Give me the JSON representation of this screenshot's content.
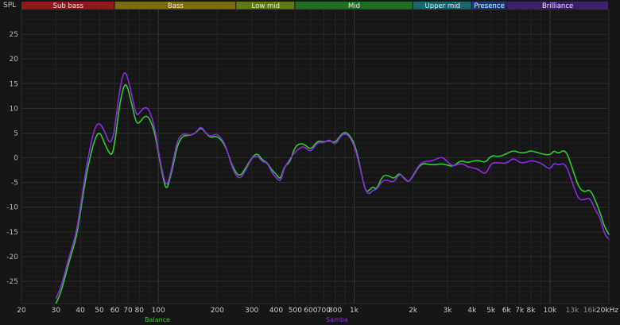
{
  "chart_data": {
    "type": "line",
    "ylabel": "SPL",
    "xscale": "log",
    "xlim": [
      20,
      20000
    ],
    "ylim": [
      -29.5,
      30
    ],
    "grid": true,
    "y_ticks": [
      25,
      20,
      15,
      10,
      5,
      0,
      -5,
      -10,
      -15,
      -20,
      -25
    ],
    "x_ticks": [
      {
        "value": 20,
        "label": "20",
        "major": true
      },
      {
        "value": 30,
        "label": "30",
        "major": true
      },
      {
        "value": 40,
        "label": "40",
        "major": true
      },
      {
        "value": 50,
        "label": "50",
        "major": true
      },
      {
        "value": 60,
        "label": "60",
        "major": true
      },
      {
        "value": 70,
        "label": "70",
        "major": true
      },
      {
        "value": 80,
        "label": "80",
        "major": true
      },
      {
        "value": 100,
        "label": "100",
        "major": true
      },
      {
        "value": 200,
        "label": "200",
        "major": true
      },
      {
        "value": 300,
        "label": "300",
        "major": true
      },
      {
        "value": 400,
        "label": "400",
        "major": true
      },
      {
        "value": 500,
        "label": "500",
        "major": true
      },
      {
        "value": 600,
        "label": "600",
        "major": true
      },
      {
        "value": 700,
        "label": "700",
        "major": true
      },
      {
        "value": 800,
        "label": "800",
        "major": true
      },
      {
        "value": 1000,
        "label": "1k",
        "major": true
      },
      {
        "value": 2000,
        "label": "2k",
        "major": true
      },
      {
        "value": 3000,
        "label": "3k",
        "major": true
      },
      {
        "value": 4000,
        "label": "4k",
        "major": true
      },
      {
        "value": 5000,
        "label": "5k",
        "major": true
      },
      {
        "value": 6000,
        "label": "6k",
        "major": true
      },
      {
        "value": 7000,
        "label": "7k",
        "major": true
      },
      {
        "value": 8000,
        "label": "8k",
        "major": true
      },
      {
        "value": 10000,
        "label": "10k",
        "major": true
      },
      {
        "value": 13000,
        "label": "13k",
        "major": false
      },
      {
        "value": 16000,
        "label": "16k",
        "major": false
      },
      {
        "value": 20000,
        "label": "20kHz",
        "major": true
      }
    ],
    "bands": [
      {
        "label": "Sub bass",
        "from": 20,
        "to": 60,
        "color": "#8b1a1a"
      },
      {
        "label": "Bass",
        "from": 60,
        "to": 250,
        "color": "#7d6a12"
      },
      {
        "label": "Low mid",
        "from": 250,
        "to": 500,
        "color": "#5f7a14"
      },
      {
        "label": "Mid",
        "from": 500,
        "to": 2000,
        "color": "#1f6f1f"
      },
      {
        "label": "Upper mid",
        "from": 2000,
        "to": 4000,
        "color": "#1b6470"
      },
      {
        "label": "Presence",
        "from": 4000,
        "to": 6000,
        "color": "#1c3f7a"
      },
      {
        "label": "Brilliance",
        "from": 6000,
        "to": 20000,
        "color": "#3e1f6e"
      }
    ],
    "series": [
      {
        "name": "Balance",
        "color": "#2ecc2e",
        "points": [
          [
            30,
            -29.5
          ],
          [
            32,
            -27
          ],
          [
            35,
            -21
          ],
          [
            38,
            -16.5
          ],
          [
            40,
            -11
          ],
          [
            43,
            -3
          ],
          [
            47,
            3.5
          ],
          [
            50,
            5.5
          ],
          [
            53,
            3
          ],
          [
            56,
            1
          ],
          [
            58,
            0.5
          ],
          [
            60,
            3
          ],
          [
            63,
            10
          ],
          [
            66,
            14
          ],
          [
            68,
            15
          ],
          [
            70,
            14
          ],
          [
            73,
            11
          ],
          [
            77,
            7
          ],
          [
            80,
            7
          ],
          [
            85,
            8.5
          ],
          [
            90,
            8.2
          ],
          [
            96,
            5
          ],
          [
            100,
            1
          ],
          [
            105,
            -3.5
          ],
          [
            110,
            -6.8
          ],
          [
            115,
            -4
          ],
          [
            120,
            -1
          ],
          [
            125,
            2.5
          ],
          [
            133,
            4.5
          ],
          [
            145,
            4.5
          ],
          [
            155,
            5
          ],
          [
            165,
            6.2
          ],
          [
            175,
            5
          ],
          [
            185,
            4
          ],
          [
            200,
            4.5
          ],
          [
            220,
            2.5
          ],
          [
            240,
            -2
          ],
          [
            260,
            -4
          ],
          [
            280,
            -2
          ],
          [
            300,
            0
          ],
          [
            320,
            1
          ],
          [
            340,
            -0.5
          ],
          [
            360,
            -1
          ],
          [
            380,
            -2.5
          ],
          [
            400,
            -3.3
          ],
          [
            420,
            -4.5
          ],
          [
            440,
            -1.7
          ],
          [
            470,
            -1
          ],
          [
            500,
            2.5
          ],
          [
            550,
            3
          ],
          [
            600,
            1.5
          ],
          [
            650,
            3.5
          ],
          [
            700,
            3.2
          ],
          [
            750,
            3.5
          ],
          [
            800,
            3
          ],
          [
            850,
            4.5
          ],
          [
            900,
            5.3
          ],
          [
            950,
            4.5
          ],
          [
            1000,
            3
          ],
          [
            1050,
            0
          ],
          [
            1100,
            -4
          ],
          [
            1150,
            -7
          ],
          [
            1200,
            -6.5
          ],
          [
            1250,
            -5.8
          ],
          [
            1300,
            -6.5
          ],
          [
            1400,
            -3.5
          ],
          [
            1500,
            -3.6
          ],
          [
            1600,
            -4.3
          ],
          [
            1700,
            -3
          ],
          [
            1800,
            -4.2
          ],
          [
            1900,
            -5
          ],
          [
            2000,
            -3.7
          ],
          [
            2200,
            -1
          ],
          [
            2500,
            -1.5
          ],
          [
            2800,
            -1.2
          ],
          [
            3000,
            -1.5
          ],
          [
            3200,
            -1.8
          ],
          [
            3500,
            -0.5
          ],
          [
            3800,
            -1
          ],
          [
            4000,
            -0.7
          ],
          [
            4300,
            -0.5
          ],
          [
            4700,
            -1
          ],
          [
            5000,
            0.5
          ],
          [
            5500,
            0.2
          ],
          [
            6000,
            0.8
          ],
          [
            6500,
            1.5
          ],
          [
            7000,
            1
          ],
          [
            7500,
            1
          ],
          [
            8000,
            1.5
          ],
          [
            9000,
            0.8
          ],
          [
            10000,
            0.5
          ],
          [
            10500,
            1.5
          ],
          [
            11000,
            0.8
          ],
          [
            12000,
            1.8
          ],
          [
            13000,
            -2
          ],
          [
            14000,
            -6
          ],
          [
            15000,
            -7
          ],
          [
            16000,
            -6.3
          ],
          [
            17000,
            -8.5
          ],
          [
            18000,
            -11
          ],
          [
            19000,
            -14
          ],
          [
            20000,
            -15.5
          ]
        ]
      },
      {
        "name": "Samba",
        "color": "#8a2be2",
        "points": [
          [
            30,
            -28.5
          ],
          [
            32,
            -26
          ],
          [
            35,
            -20
          ],
          [
            38,
            -15.5
          ],
          [
            40,
            -10
          ],
          [
            43,
            -1.5
          ],
          [
            47,
            6
          ],
          [
            50,
            7.2
          ],
          [
            53,
            5.5
          ],
          [
            56,
            3
          ],
          [
            58,
            3.5
          ],
          [
            60,
            6
          ],
          [
            63,
            13
          ],
          [
            66,
            17
          ],
          [
            68,
            17.3
          ],
          [
            70,
            16
          ],
          [
            73,
            13
          ],
          [
            77,
            8.5
          ],
          [
            80,
            9
          ],
          [
            85,
            10.3
          ],
          [
            90,
            9.8
          ],
          [
            96,
            6
          ],
          [
            100,
            1.5
          ],
          [
            105,
            -3
          ],
          [
            110,
            -6
          ],
          [
            115,
            -3.5
          ],
          [
            120,
            0
          ],
          [
            125,
            3.5
          ],
          [
            133,
            5
          ],
          [
            145,
            4.5
          ],
          [
            155,
            5
          ],
          [
            165,
            6.5
          ],
          [
            175,
            5
          ],
          [
            185,
            4.2
          ],
          [
            200,
            5
          ],
          [
            220,
            2.8
          ],
          [
            240,
            -2.5
          ],
          [
            260,
            -4.5
          ],
          [
            280,
            -2.5
          ],
          [
            300,
            0
          ],
          [
            320,
            0.5
          ],
          [
            340,
            -0.8
          ],
          [
            360,
            -1
          ],
          [
            380,
            -3
          ],
          [
            400,
            -4
          ],
          [
            420,
            -5
          ],
          [
            440,
            -2
          ],
          [
            470,
            -0.2
          ],
          [
            500,
            1.2
          ],
          [
            550,
            2.5
          ],
          [
            600,
            1
          ],
          [
            650,
            3.2
          ],
          [
            700,
            3
          ],
          [
            750,
            3.8
          ],
          [
            800,
            2.5
          ],
          [
            850,
            4.3
          ],
          [
            900,
            5
          ],
          [
            950,
            4.2
          ],
          [
            1000,
            2.5
          ],
          [
            1050,
            -0.5
          ],
          [
            1100,
            -4
          ],
          [
            1150,
            -7
          ],
          [
            1200,
            -7.3
          ],
          [
            1250,
            -6.5
          ],
          [
            1300,
            -6.5
          ],
          [
            1400,
            -4.5
          ],
          [
            1500,
            -4.6
          ],
          [
            1600,
            -5
          ],
          [
            1700,
            -3.2
          ],
          [
            1800,
            -4
          ],
          [
            1900,
            -5
          ],
          [
            2000,
            -3.5
          ],
          [
            2200,
            -0.8
          ],
          [
            2500,
            -0.7
          ],
          [
            2800,
            0.3
          ],
          [
            3000,
            -0.8
          ],
          [
            3200,
            -1.8
          ],
          [
            3500,
            -1
          ],
          [
            3800,
            -1.8
          ],
          [
            4000,
            -2
          ],
          [
            4300,
            -2.3
          ],
          [
            4700,
            -3.5
          ],
          [
            5000,
            -1
          ],
          [
            5500,
            -1
          ],
          [
            6000,
            -1.2
          ],
          [
            6500,
            0
          ],
          [
            7000,
            -1
          ],
          [
            7500,
            -1
          ],
          [
            8000,
            -0.5
          ],
          [
            9000,
            -1
          ],
          [
            10000,
            -2.5
          ],
          [
            10500,
            -1
          ],
          [
            11000,
            -1.5
          ],
          [
            12000,
            -1
          ],
          [
            13000,
            -5
          ],
          [
            14000,
            -8.5
          ],
          [
            15000,
            -8.5
          ],
          [
            16000,
            -8
          ],
          [
            17000,
            -10.5
          ],
          [
            18000,
            -12
          ],
          [
            19000,
            -15.5
          ],
          [
            20000,
            -16.5
          ]
        ]
      }
    ]
  }
}
